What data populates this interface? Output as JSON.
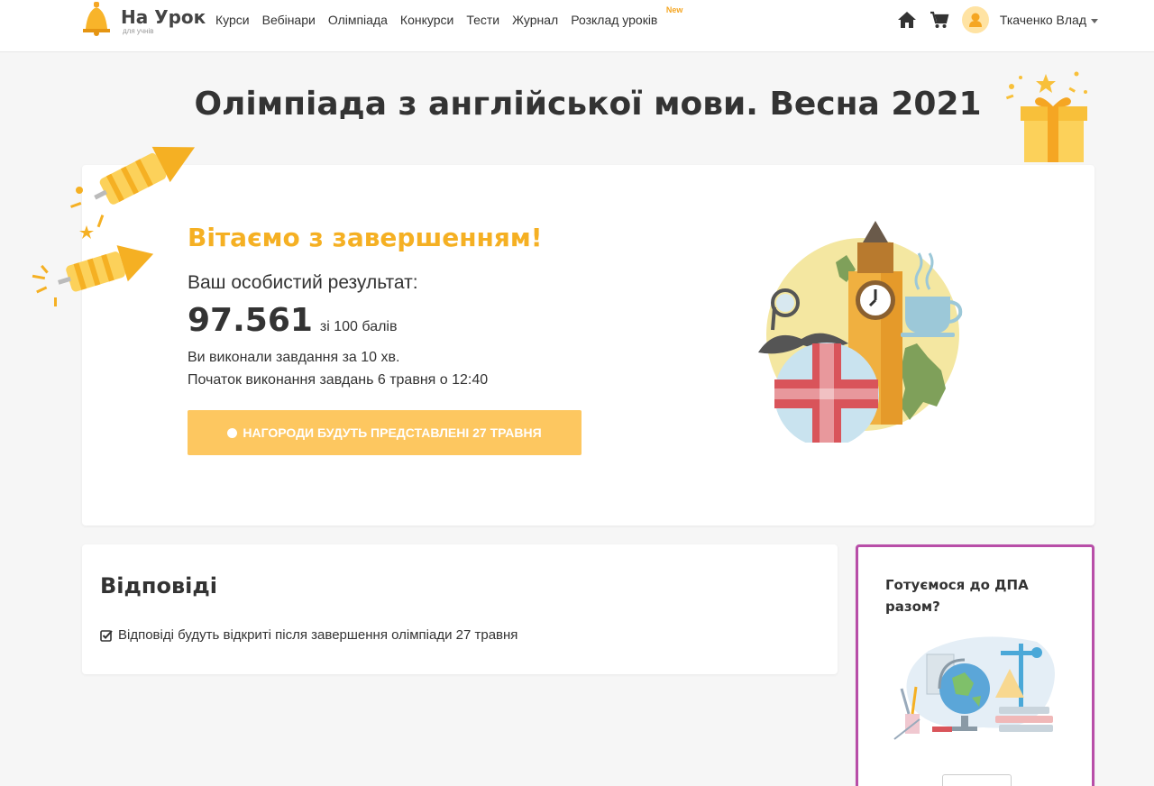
{
  "navbar": {
    "logo_title": "На Урок",
    "logo_subtitle": "для учнів",
    "links": [
      "Курси",
      "Вебінари",
      "Олімпіада",
      "Конкурси",
      "Тести",
      "Журнал",
      "Розклад уроків"
    ],
    "new_badge": "New",
    "icons": [
      "home-icon",
      "cart-icon",
      "user-icon"
    ],
    "user_name": "Ткаченко Влад"
  },
  "page": {
    "title": "Олімпіада з англійської мови. Весна 2021"
  },
  "result": {
    "congrats": "Вітаємо з завершенням!",
    "result_label": "Ваш особистий результат:",
    "score": "97.561",
    "score_of": "зі 100 балів",
    "time_text": "Ви виконали завдання за 10 хв.",
    "start_text": "Початок виконання завдань 6 травня о 12:40",
    "award_button": "НАГОРОДИ БУДУТЬ ПРЕДСТАВЛЕНІ 27 ТРАВНЯ"
  },
  "answers": {
    "title": "Відповіді",
    "note": "Відповіді будуть відкриті після завершення олімпіади 27 травня"
  },
  "dpa": {
    "title": "Готуємося до ДПА разом?"
  },
  "colors": {
    "accent": "#f5b023",
    "button": "#fdc760",
    "dpa_border": "#b84ea8"
  }
}
